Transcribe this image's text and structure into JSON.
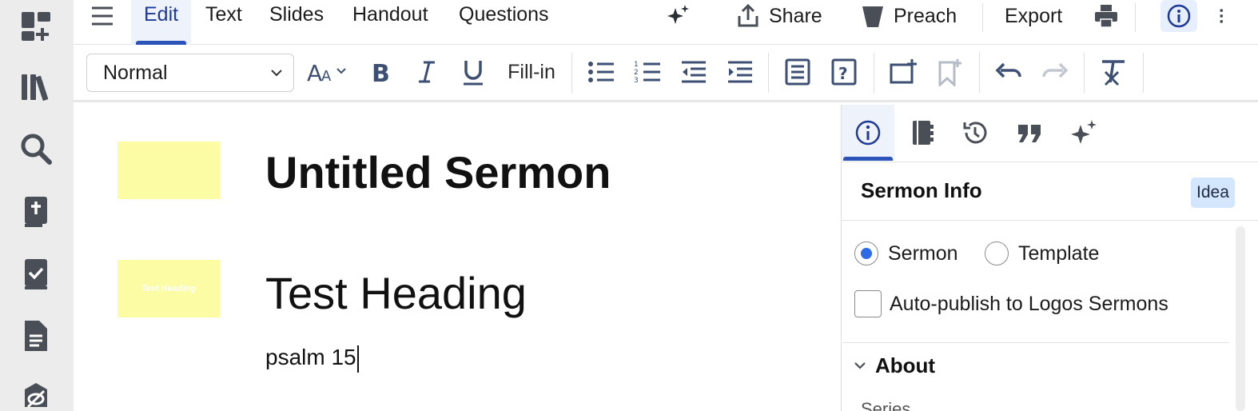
{
  "menu": {
    "tabs": [
      {
        "label": "Edit",
        "active": true
      },
      {
        "label": "Text"
      },
      {
        "label": "Slides"
      },
      {
        "label": "Handout"
      },
      {
        "label": "Questions"
      }
    ],
    "actions": {
      "share": "Share",
      "preach": "Preach",
      "export": "Export"
    }
  },
  "toolbar": {
    "style_value": "Normal",
    "fill_in": "Fill-in"
  },
  "document": {
    "title": "Untitled Sermon",
    "heading": "Test Heading",
    "heading_thumb_text": "Test Heading",
    "body": "psalm 15"
  },
  "panel": {
    "title": "Sermon Info",
    "badge": "Idea",
    "type_options": [
      {
        "label": "Sermon",
        "checked": true
      },
      {
        "label": "Template",
        "checked": false
      }
    ],
    "autopublish_label": "Auto-publish to Logos Sermons",
    "autopublish_checked": false,
    "about_label": "About",
    "next_label_partial": "Series"
  },
  "colors": {
    "accent": "#2c53b8",
    "rail_bg": "#ececec",
    "thumb_bg": "#fbfca3",
    "badge_bg": "#d4e6fb",
    "radio_checked": "#2e6be6"
  },
  "icons": {
    "rail": [
      "dashboard-add-icon",
      "library-icon",
      "search-icon",
      "bible-icon",
      "checklist-book-icon",
      "document-icon",
      "eye-slash-icon"
    ],
    "top": [
      "menu-icon",
      "sparkle-icon",
      "share-icon",
      "preach-icon",
      "print-icon",
      "info-icon",
      "more-vertical-icon"
    ],
    "toolbar": [
      "text-size-icon",
      "bold-icon",
      "italic-icon",
      "underline-icon",
      "bullet-list-icon",
      "numbered-list-icon",
      "outdent-icon",
      "indent-icon",
      "notes-icon",
      "question-icon",
      "add-slide-icon",
      "bookmark-add-icon",
      "undo-icon",
      "redo-icon",
      "clear-format-icon"
    ],
    "panel_tabs": [
      "info-icon",
      "notebook-icon",
      "history-icon",
      "quote-icon",
      "sparkle-icon"
    ]
  }
}
